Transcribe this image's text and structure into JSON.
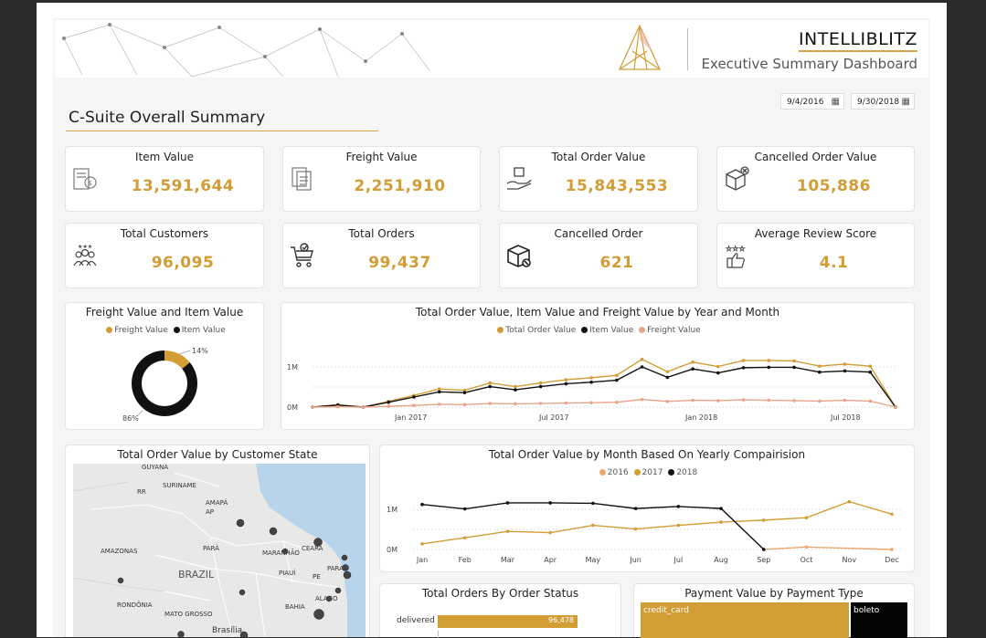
{
  "header": {
    "brand": "INTELLIBLITZ",
    "subtitle": "Executive Summary Dashboard"
  },
  "filters": {
    "start_date": "9/4/2016",
    "end_date": "9/30/2018"
  },
  "page_title": "C-Suite Overall Summary",
  "kpis": [
    {
      "label": "Item Value",
      "value": "13,591,644",
      "icon": "receipt-icon"
    },
    {
      "label": "Freight Value",
      "value": "2,251,910",
      "icon": "invoice-icon"
    },
    {
      "label": "Total Order Value",
      "value": "15,843,553",
      "icon": "hand-box-icon"
    },
    {
      "label": "Cancelled Order Value",
      "value": "105,886",
      "icon": "cancelled-box-icon"
    },
    {
      "label": "Total Customers",
      "value": "96,095",
      "icon": "customers-icon"
    },
    {
      "label": "Total Orders",
      "value": "99,437",
      "icon": "cart-icon"
    },
    {
      "label": "Cancelled Order",
      "value": "621",
      "icon": "box-cancel-icon"
    },
    {
      "label": "Average Review Score",
      "value": "4.1",
      "icon": "review-stars-icon"
    }
  ],
  "colors": {
    "gold": "#d39d36",
    "black": "#111111",
    "salmon": "#e8a58b",
    "orange_light": "#e9a96e"
  },
  "donut": {
    "title": "Freight Value and Item Value",
    "legend": [
      "Freight Value",
      "Item Value"
    ],
    "label_small": "14%",
    "label_large": "86%"
  },
  "trend": {
    "title": "Total Order Value, Item Value and Freight Value by Year and Month",
    "legend": [
      "Total Order Value",
      "Item Value",
      "Freight Value"
    ],
    "y_ticks": [
      "1M",
      "0M"
    ],
    "x_ticks": [
      "Jan 2017",
      "Jul 2017",
      "Jan 2018",
      "Jul 2018"
    ]
  },
  "map": {
    "title": "Total Order Value by Customer State",
    "labels": [
      "GUYANA",
      "SURINAME",
      "RR",
      "AMAPÁ",
      "AP",
      "AMAZONAS",
      "PARÁ",
      "MARANHÃO",
      "CEARÁ",
      "BRAZIL",
      "PIAUÍ",
      "PARAÍ",
      "PE",
      "RONDÔNIA",
      "MATO GROSSO",
      "BAHIA",
      "ALAGO",
      "Brasília"
    ]
  },
  "monthly": {
    "title": "Total Order Value by Month Based On Yearly Compairision",
    "legend": [
      "2016",
      "2017",
      "2018"
    ],
    "y_ticks": [
      "1M",
      "0M"
    ],
    "x_ticks": [
      "Jan",
      "Feb",
      "Mar",
      "Apr",
      "May",
      "Jun",
      "Jul",
      "Aug",
      "Sep",
      "Oct",
      "Nov",
      "Dec"
    ]
  },
  "status": {
    "title": "Total Orders By Order Status",
    "row_label": "delivered",
    "row_value": "96,478"
  },
  "payment": {
    "title": "Payment Value by Payment Type",
    "tile1": "credit_card",
    "tile2": "boleto"
  },
  "chart_data": [
    {
      "type": "pie",
      "title": "Freight Value and Item Value",
      "categories": [
        "Freight Value",
        "Item Value"
      ],
      "values": [
        14,
        86
      ]
    },
    {
      "type": "line",
      "title": "Total Order Value, Item Value and Freight Value by Year and Month",
      "x": [
        "2016-09",
        "2016-10",
        "2016-12",
        "2017-01",
        "2017-02",
        "2017-03",
        "2017-04",
        "2017-05",
        "2017-06",
        "2017-07",
        "2017-08",
        "2017-09",
        "2017-10",
        "2017-11",
        "2017-12",
        "2018-01",
        "2018-02",
        "2018-03",
        "2018-04",
        "2018-05",
        "2018-06",
        "2018-07",
        "2018-08",
        "2018-09"
      ],
      "series": [
        {
          "name": "Total Order Value",
          "values": [
            0.0003,
            0.06,
            2e-05,
            0.14,
            0.29,
            0.45,
            0.42,
            0.6,
            0.51,
            0.6,
            0.68,
            0.73,
            0.79,
            1.19,
            0.88,
            1.12,
            1.01,
            1.16,
            1.16,
            1.15,
            1.02,
            1.07,
            1.02,
            0.0002
          ]
        },
        {
          "name": "Item Value",
          "values": [
            0.0002,
            0.05,
            1e-05,
            0.12,
            0.25,
            0.38,
            0.36,
            0.51,
            0.43,
            0.51,
            0.58,
            0.62,
            0.67,
            1.0,
            0.74,
            0.95,
            0.85,
            0.98,
            0.99,
            0.99,
            0.87,
            0.9,
            0.87,
            0.0001
          ]
        },
        {
          "name": "Freight Value",
          "values": [
            5e-05,
            0.008,
            2e-06,
            0.02,
            0.04,
            0.07,
            0.06,
            0.09,
            0.08,
            0.09,
            0.1,
            0.11,
            0.12,
            0.19,
            0.14,
            0.17,
            0.16,
            0.18,
            0.17,
            0.16,
            0.15,
            0.17,
            0.15,
            5e-05
          ]
        }
      ],
      "ylabel": "",
      "xlabel": "",
      "ylim": [
        0,
        1.3
      ]
    },
    {
      "type": "line",
      "title": "Total Order Value by Month Based On Yearly Compairision",
      "categories": [
        "Jan",
        "Feb",
        "Mar",
        "Apr",
        "May",
        "Jun",
        "Jul",
        "Aug",
        "Sep",
        "Oct",
        "Nov",
        "Dec"
      ],
      "series": [
        {
          "name": "2016",
          "values": [
            null,
            null,
            null,
            null,
            null,
            null,
            null,
            null,
            0.0003,
            0.06,
            null,
            2e-05
          ]
        },
        {
          "name": "2017",
          "values": [
            0.14,
            0.29,
            0.45,
            0.42,
            0.6,
            0.51,
            0.6,
            0.68,
            0.73,
            0.79,
            1.19,
            0.88
          ]
        },
        {
          "name": "2018",
          "values": [
            1.12,
            1.01,
            1.16,
            1.16,
            1.15,
            1.02,
            1.07,
            1.02,
            0.0002,
            null,
            null,
            null
          ]
        }
      ],
      "ylim": [
        0,
        1.3
      ]
    },
    {
      "type": "bar",
      "title": "Total Orders By Order Status",
      "categories": [
        "delivered"
      ],
      "values": [
        96478
      ]
    }
  ]
}
